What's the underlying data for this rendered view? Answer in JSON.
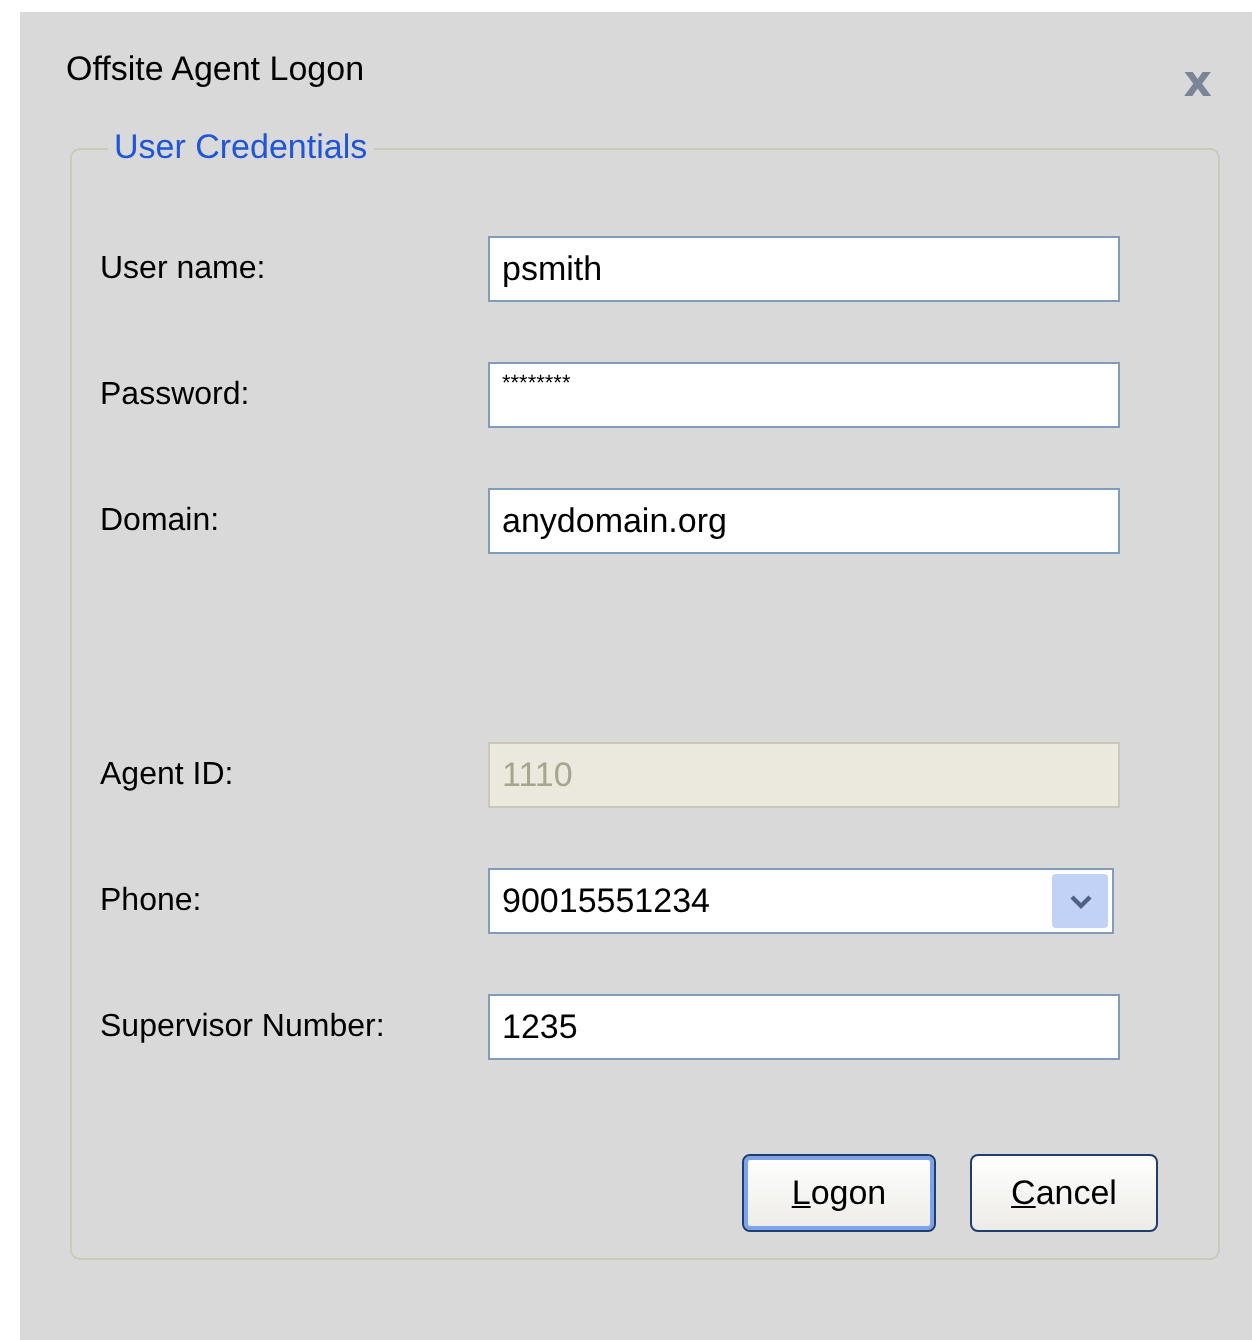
{
  "window": {
    "title": "Offsite Agent Logon",
    "close": "x"
  },
  "group": {
    "title": "User Credentials"
  },
  "sections": [
    [
      {
        "label": "User name:",
        "value": "psmith",
        "kind": "text",
        "disabled": false
      },
      {
        "label": "Password:",
        "value": "********",
        "kind": "password",
        "disabled": false
      },
      {
        "label": "Domain:",
        "value": "anydomain.org",
        "kind": "text",
        "disabled": false
      }
    ],
    [
      {
        "label": "Agent ID:",
        "value": "1110",
        "kind": "text",
        "disabled": true
      },
      {
        "label": "Phone:",
        "value": "90015551234",
        "kind": "dropdown",
        "disabled": false
      },
      {
        "label": "Supervisor Number:",
        "value": "1235",
        "kind": "text",
        "disabled": false
      }
    ]
  ],
  "buttons": [
    {
      "access_key": "L",
      "rest": "ogon",
      "default": true
    },
    {
      "access_key": "C",
      "rest": "ancel",
      "default": false
    }
  ]
}
